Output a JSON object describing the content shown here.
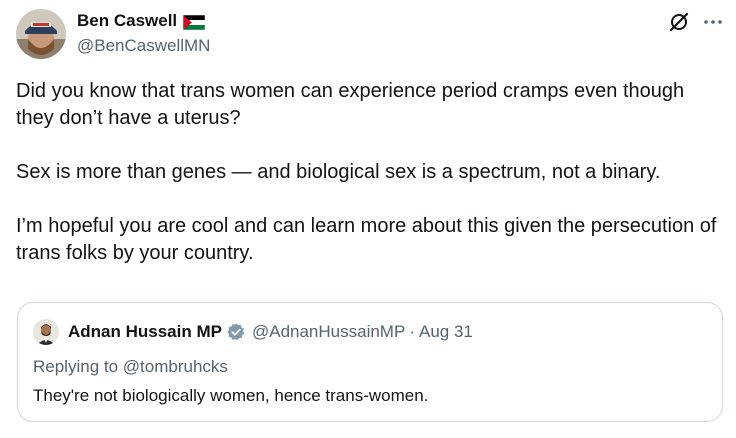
{
  "author": {
    "name": "Ben Caswell",
    "handle": "@BenCaswellMN",
    "flag_icon": "palestine-flag-icon"
  },
  "actions": {
    "grok_icon": "grok-icon",
    "more_icon": "more-icon"
  },
  "post": {
    "paragraphs": [
      "Did you know that trans women can experience period cramps even though they don’t have a uterus?",
      "Sex is more than genes — and biological sex is a spectrum, not a binary.",
      "I’m hopeful you are cool and can learn more about this given the persecution of trans folks by your country."
    ]
  },
  "quoted_post": {
    "name": "Adnan Hussain MP",
    "handle": "@AdnanHussainMP",
    "separator": "·",
    "date": "Aug 31",
    "reply_prefix": "Replying to",
    "reply_handle": "@tombruhcks",
    "text": "They're not biologically women, hence trans-women."
  },
  "colors": {
    "text_primary": "#0f1419",
    "text_secondary": "#536471",
    "verified_gray": "#829aab",
    "border": "#cfd9de"
  }
}
